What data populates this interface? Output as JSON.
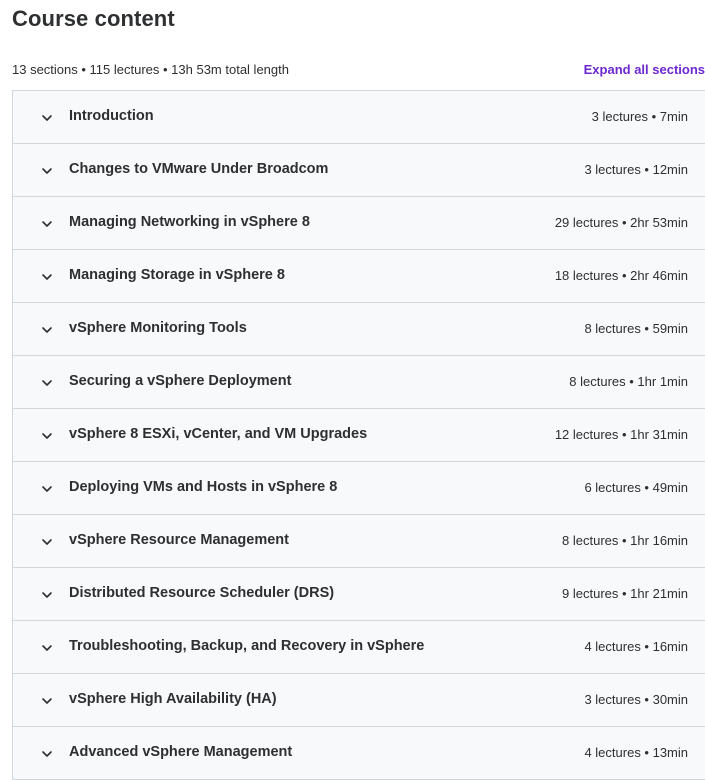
{
  "header": {
    "title": "Course content",
    "summary": "13 sections • 115 lectures • 13h 53m total length",
    "expand_all_label": "Expand all sections"
  },
  "sections": [
    {
      "title": "Introduction",
      "meta": "3 lectures • 7min"
    },
    {
      "title": "Changes to VMware Under Broadcom",
      "meta": "3 lectures • 12min"
    },
    {
      "title": "Managing Networking in vSphere 8",
      "meta": "29 lectures • 2hr 53min"
    },
    {
      "title": "Managing Storage in vSphere 8",
      "meta": "18 lectures • 2hr 46min"
    },
    {
      "title": "vSphere Monitoring Tools",
      "meta": "8 lectures • 59min"
    },
    {
      "title": "Securing a vSphere Deployment",
      "meta": "8 lectures • 1hr 1min"
    },
    {
      "title": "vSphere 8 ESXi, vCenter, and VM Upgrades",
      "meta": "12 lectures • 1hr 31min"
    },
    {
      "title": "Deploying VMs and Hosts in vSphere 8",
      "meta": "6 lectures • 49min"
    },
    {
      "title": "vSphere Resource Management",
      "meta": "8 lectures • 1hr 16min"
    },
    {
      "title": "Distributed Resource Scheduler (DRS)",
      "meta": "9 lectures • 1hr 21min"
    },
    {
      "title": "Troubleshooting, Backup, and Recovery in vSphere",
      "meta": "4 lectures • 16min"
    },
    {
      "title": "vSphere High Availability (HA)",
      "meta": "3 lectures • 30min"
    },
    {
      "title": "Advanced vSphere Management",
      "meta": "4 lectures • 13min"
    }
  ],
  "icons": {
    "section_toggle": "chevron-down-icon"
  },
  "colors": {
    "accent": "#6d28d2",
    "row_background": "#f7f9fa",
    "border": "#d1d7dc",
    "text": "#2d2f31"
  }
}
